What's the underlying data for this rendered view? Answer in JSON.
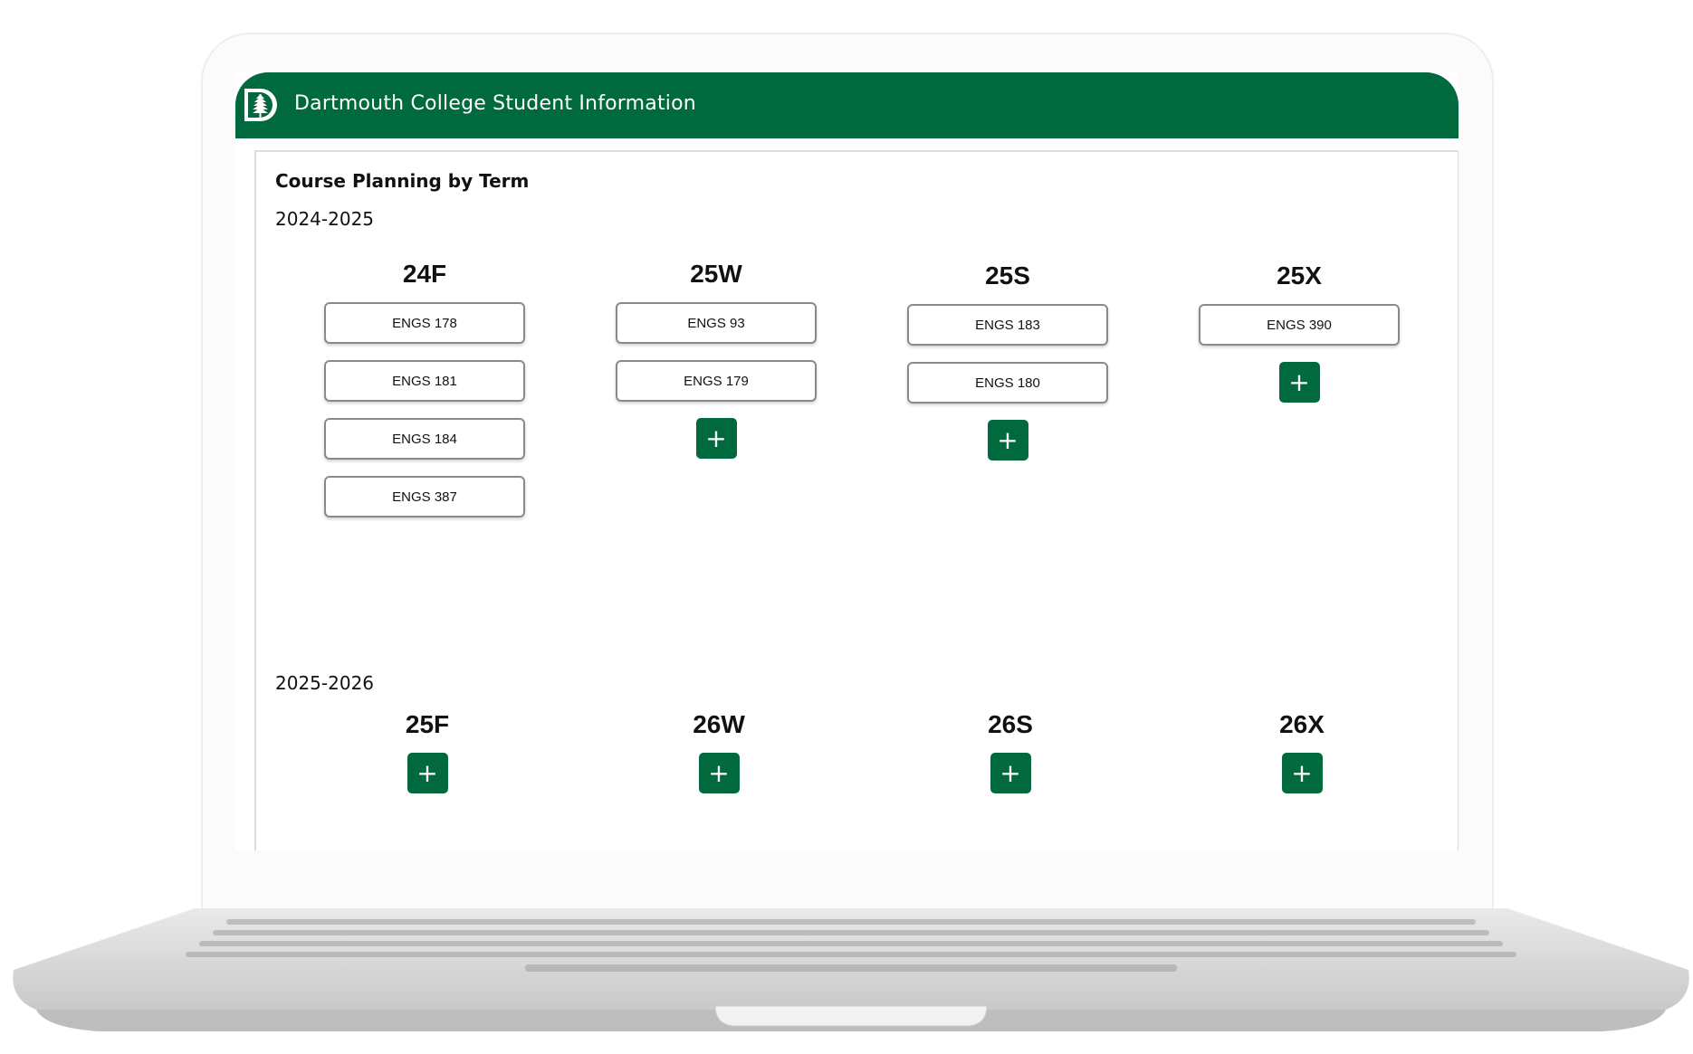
{
  "header": {
    "title": "Dartmouth College Student Information",
    "logo_icon": "dartmouth-pine-logo",
    "color": "#00693e"
  },
  "page": {
    "title": "Course Planning by Term"
  },
  "years": [
    {
      "label": "2024-2025",
      "terms": [
        {
          "label": "24F",
          "courses": [
            "ENGS 178",
            "ENGS 181",
            "ENGS 184",
            "ENGS 387"
          ]
        },
        {
          "label": "25W",
          "courses": [
            "ENGS 93",
            "ENGS 179"
          ]
        },
        {
          "label": "25S",
          "courses": [
            "ENGS 183",
            "ENGS 180"
          ]
        },
        {
          "label": "25X",
          "courses": [
            "ENGS 390"
          ]
        }
      ]
    },
    {
      "label": "2025-2026",
      "terms": [
        {
          "label": "25F",
          "courses": []
        },
        {
          "label": "26W",
          "courses": []
        },
        {
          "label": "26S",
          "courses": []
        },
        {
          "label": "26X",
          "courses": []
        }
      ]
    }
  ],
  "add_button": {
    "label": "+",
    "icon": "plus-icon"
  }
}
